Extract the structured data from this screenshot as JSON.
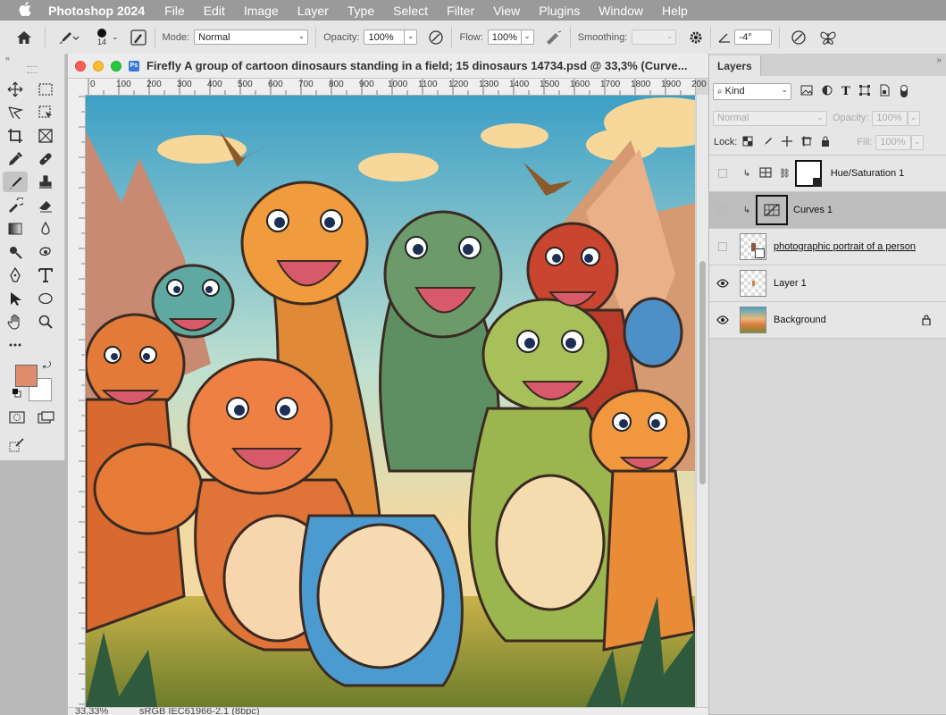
{
  "menubar": {
    "app_name": "Photoshop 2024",
    "items": [
      "File",
      "Edit",
      "Image",
      "Layer",
      "Type",
      "Select",
      "Filter",
      "View",
      "Plugins",
      "Window",
      "Help"
    ]
  },
  "options_bar": {
    "brush_size": "14",
    "mode_label": "Mode:",
    "mode_value": "Normal",
    "opacity_label": "Opacity:",
    "opacity_value": "100%",
    "flow_label": "Flow:",
    "flow_value": "100%",
    "smoothing_label": "Smoothing:",
    "smoothing_value": "",
    "angle_value": "-4°"
  },
  "tools": {
    "foreground_color": "#df8c6e",
    "background_color": "#ffffff",
    "active_tool": "brush-tool"
  },
  "document": {
    "title": "Firefly A group of cartoon dinosaurs standing in a field; 15 dinosaurs 14734.psd @ 33,3% (Curve...",
    "zoom": "33,33%",
    "color_profile": "sRGB IEC61966-2.1 (8bpc)",
    "ruler_h": [
      "0",
      "100",
      "200",
      "300",
      "400",
      "500",
      "600",
      "700",
      "800",
      "900",
      "1000",
      "1100",
      "1200",
      "1300",
      "1400",
      "1500",
      "1600",
      "1700",
      "1800",
      "1900",
      "200"
    ]
  },
  "layers_panel": {
    "tab": "Layers",
    "filter_kind": "Kind",
    "blend_mode": "Normal",
    "opacity_label": "Opacity:",
    "opacity_value": "100%",
    "lock_label": "Lock:",
    "fill_label": "Fill:",
    "fill_value": "100%",
    "layers": [
      {
        "name": "Hue/Saturation 1",
        "visible": false,
        "type": "adjustment",
        "clipped": true
      },
      {
        "name": "Curves 1",
        "visible": false,
        "type": "adjustment",
        "clipped": true,
        "selected": true
      },
      {
        "name": "photographic portrait of a person",
        "visible": false,
        "type": "smart-object"
      },
      {
        "name": "Layer 1",
        "visible": true,
        "type": "pixel"
      },
      {
        "name": "Background",
        "visible": true,
        "type": "background",
        "locked": true
      }
    ]
  }
}
